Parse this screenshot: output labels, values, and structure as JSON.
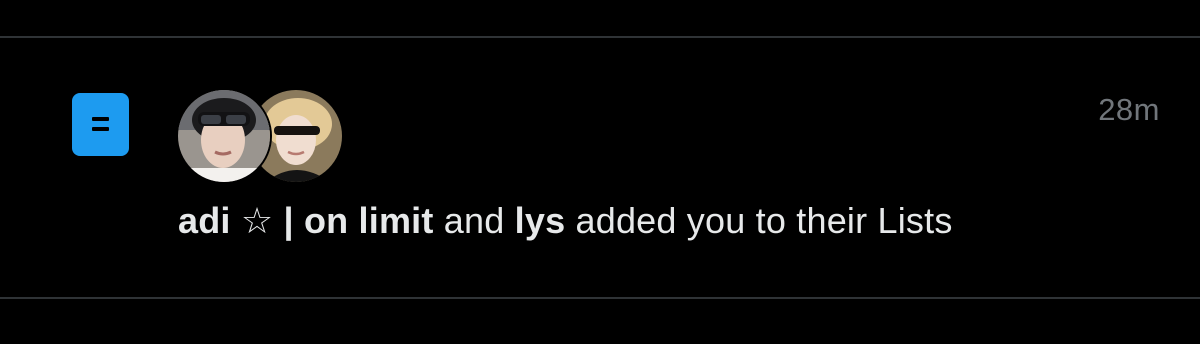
{
  "notification": {
    "timestamp": "28m",
    "user1_name": "adi ☆ | on limit",
    "conjunction": " and ",
    "user2_name": "lys",
    "action_text": " added you to their Lists",
    "icon": "list-icon",
    "avatars": [
      {
        "name": "avatar-adi",
        "alt": "adi"
      },
      {
        "name": "avatar-lys",
        "alt": "lys"
      }
    ]
  },
  "colors": {
    "background": "#000000",
    "divider": "#2f3336",
    "accent": "#1d9bf0",
    "text_primary": "#e7e9ea",
    "text_secondary": "#71767b"
  }
}
